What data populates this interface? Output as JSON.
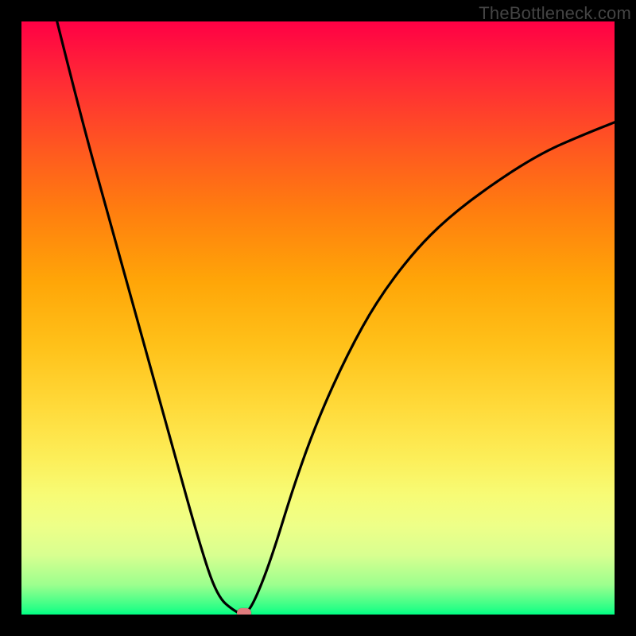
{
  "watermark": "TheBottleneck.com",
  "chart_data": {
    "type": "line",
    "title": "",
    "xlabel": "",
    "ylabel": "",
    "xlim": [
      0,
      100
    ],
    "ylim": [
      0,
      100
    ],
    "grid": false,
    "legend": false,
    "background_gradient": {
      "direction": "vertical",
      "stops": [
        {
          "pos": 0,
          "color": "#ff0045"
        },
        {
          "pos": 50,
          "color": "#ffc21a"
        },
        {
          "pos": 80,
          "color": "#f7fc76"
        },
        {
          "pos": 100,
          "color": "#00ff84"
        }
      ]
    },
    "series": [
      {
        "name": "bottleneck-curve",
        "color": "#000000",
        "x": [
          6,
          10,
          15,
          20,
          25,
          30,
          33,
          36,
          37.5,
          39,
          42,
          46,
          50,
          55,
          60,
          66,
          72,
          80,
          88,
          95,
          100
        ],
        "y": [
          100,
          84,
          66,
          48,
          30,
          12,
          3,
          0.5,
          0,
          1.5,
          9,
          22,
          33,
          44,
          53,
          61,
          67,
          73,
          78,
          81,
          83
        ]
      }
    ],
    "marker": {
      "name": "optimal-point",
      "x": 37.5,
      "y": 0,
      "color": "#e07b7d"
    }
  }
}
